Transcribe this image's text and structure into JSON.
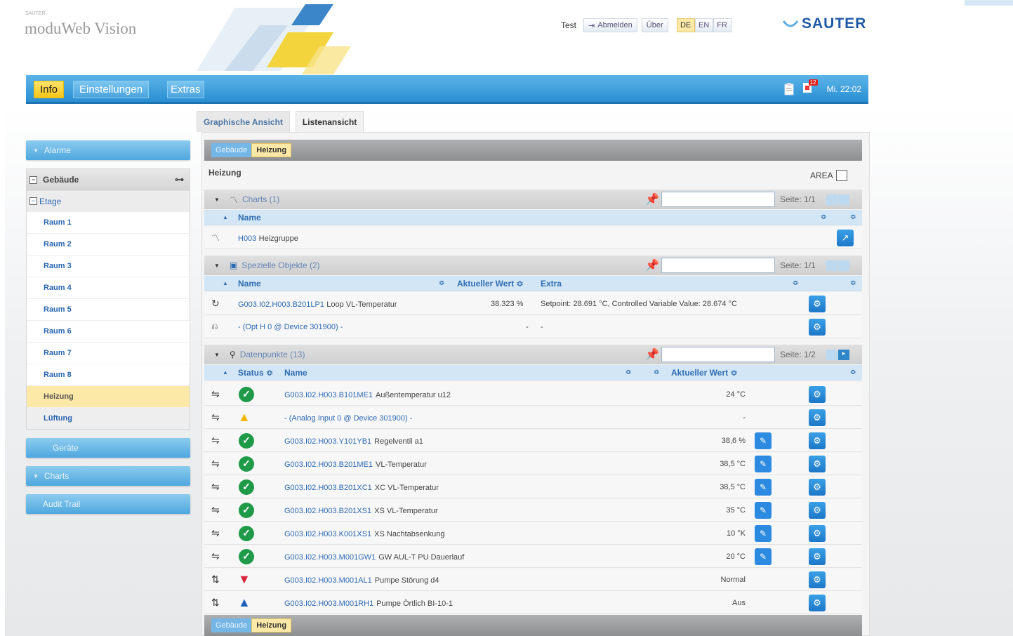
{
  "header": {
    "brand_small": "SAUTER",
    "brand": "moduWeb Vision",
    "user": "Test",
    "logout": "Abmelden",
    "about": "Über",
    "languages": [
      "DE",
      "EN",
      "FR"
    ],
    "active_language": "DE",
    "logo": "SAUTER"
  },
  "nav": {
    "items": [
      "Info",
      "Einstellungen",
      "Extras"
    ],
    "active": "Info",
    "alarm_count": "12",
    "clock": "Mi. 22:02",
    "icons": [
      "clipboard-icon",
      "alarm-bell-icon"
    ]
  },
  "sidebar": {
    "alarme": "Alarme",
    "gebaeude": "Gebäude",
    "etage": "Etage",
    "rooms": [
      "Raum 1",
      "Raum 2",
      "Raum 3",
      "Raum 4",
      "Raum 5",
      "Raum 6",
      "Raum 7",
      "Raum 8",
      "Heizung",
      "Lüftung"
    ],
    "selected": "Heizung",
    "geraete": "Geräte",
    "charts": "Charts",
    "audit": "Audit Trail"
  },
  "tabs": [
    "Graphische Ansicht",
    "Listenansicht"
  ],
  "active_tab": "Listenansicht",
  "breadcrumb": [
    "Gebäude",
    "Heizung"
  ],
  "main": {
    "title": "Heizung",
    "area_label": "AREA",
    "charts_section": {
      "title": "Charts (1)",
      "page": "Seite: 1/1",
      "col_name": "Name",
      "rows": [
        {
          "id": "H003",
          "desc": "Heizgruppe"
        }
      ]
    },
    "special_section": {
      "title": "Spezielle Objekte (2)",
      "page": "Seite: 1/1",
      "col_name": "Name",
      "col_value": "Aktueller Wert ≎",
      "col_extra": "Extra",
      "rows": [
        {
          "id": "G003.I02.H003.B201LP1",
          "desc": "Loop VL-Temperatur",
          "value": "38.323 %",
          "extra": "Setpoint: 28.691 °C, Controlled Variable Value: 28.674 °C"
        },
        {
          "id": "- (Opt H 0 @ Device 301900) -",
          "desc": "",
          "value": "-",
          "extra": "-"
        }
      ]
    },
    "datapoints_section": {
      "title": "Datenpunkte (13)",
      "page": "Seite: 1/2",
      "col_status": "Status ≎",
      "col_name": "Name",
      "col_value": "Aktueller Wert ≎",
      "rows": [
        {
          "status": "ok",
          "id": "G003.I02.H003.B101ME1",
          "desc": "Außentemperatur u12",
          "value": "24 °C",
          "editable": false
        },
        {
          "status": "warn",
          "id": "- (Analog Input 0 @ Device 301900) -",
          "desc": "",
          "value": "-",
          "editable": false
        },
        {
          "status": "ok",
          "id": "G003.I02.H003.Y101YB1",
          "desc": "Regelventil a1",
          "value": "38,6 %",
          "editable": true
        },
        {
          "status": "ok",
          "id": "G003.I02.H003.B201ME1",
          "desc": "VL-Temperatur",
          "value": "38,5 °C",
          "editable": true
        },
        {
          "status": "ok",
          "id": "G003.I02.H003.B201XC1",
          "desc": "XC VL-Temperatur",
          "value": "38,5 °C",
          "editable": true
        },
        {
          "status": "ok",
          "id": "G003.I02.H003.B201XS1",
          "desc": "XS VL-Temperatur",
          "value": "35 °C",
          "editable": true
        },
        {
          "status": "ok",
          "id": "G003.I02.H003.K001XS1",
          "desc": "XS Nachtabsenkung",
          "value": "10 °K",
          "editable": true
        },
        {
          "status": "ok",
          "id": "G003.I02.H003.M001GW1",
          "desc": "GW AUL-T PU Dauerlauf",
          "value": "20 °C",
          "editable": true
        },
        {
          "status": "alarm",
          "id": "G003.I02.H003.M001AL1",
          "desc": "Pumpe Störung d4",
          "value": "Normal",
          "editable": false
        },
        {
          "status": "info",
          "id": "G003.I02.H003.M001RH1",
          "desc": "Pumpe Örtlich BI-10-1",
          "value": "Aus",
          "editable": false
        }
      ]
    }
  }
}
